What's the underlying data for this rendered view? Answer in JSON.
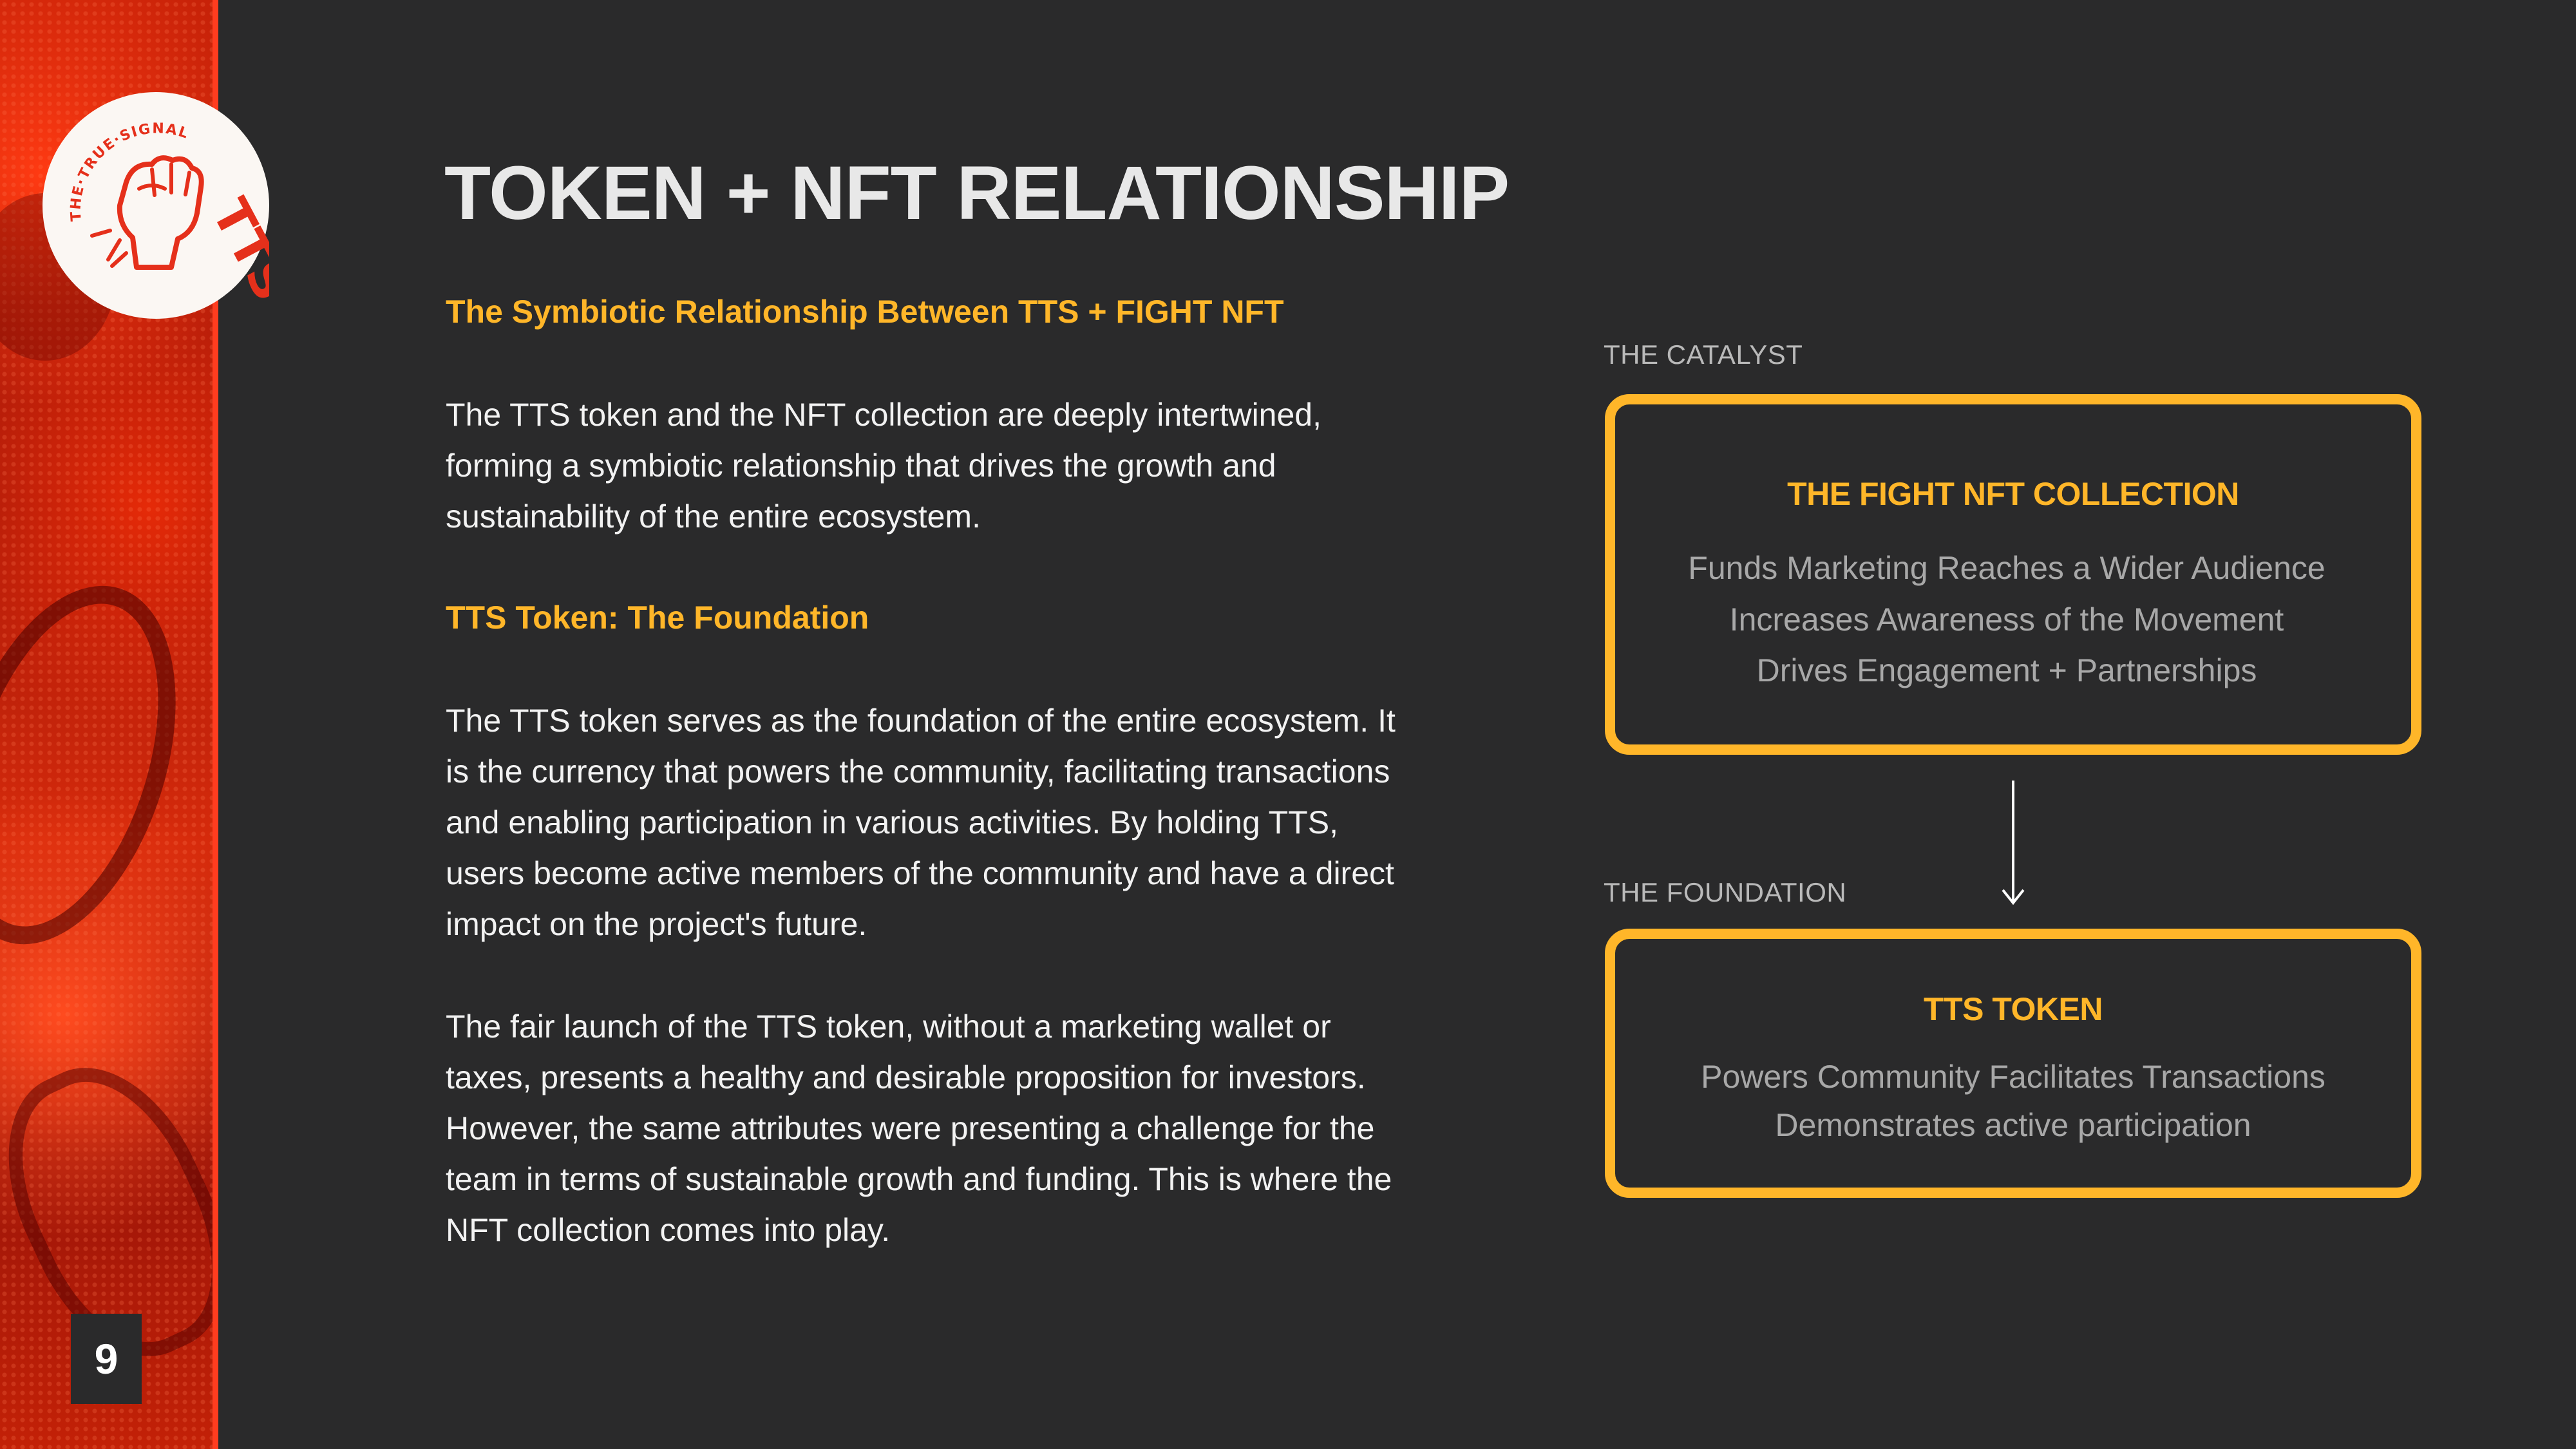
{
  "page": {
    "number": "9",
    "title": "TOKEN + NFT RELATIONSHIP"
  },
  "logo": {
    "text_top": "THE·TRUE·SIGNAL",
    "text_side": "TTS",
    "icon": "raised-fist-icon"
  },
  "left": {
    "subheading_1": "The Symbiotic Relationship Between TTS + FIGHT NFT",
    "paragraph_1": "The TTS token and the NFT collection are deeply intertwined, forming a symbiotic relationship that drives the growth and sustainability of the entire ecosystem.",
    "subheading_2": "TTS Token: The Foundation",
    "paragraph_2": "The TTS token serves as the foundation of the entire ecosystem. It is the currency that powers the community, facilitating transactions and enabling participation in various activities. By holding TTS, users become active members of the community and have a direct impact on the project's future.",
    "paragraph_3": "The fair launch of the TTS token, without a marketing wallet or taxes, presents a healthy and desirable proposition for investors. However, the same attributes were presenting a challenge for the team in terms of sustainable growth and funding. This is where the NFT collection comes into play."
  },
  "diagram": {
    "catalyst": {
      "label": "THE CATALYST",
      "title": "THE FIGHT NFT COLLECTION",
      "line_1": "Funds Marketing   Reaches a Wider Audience",
      "line_2": "Increases Awareness of the Movement",
      "line_3": "Drives Engagement + Partnerships"
    },
    "arrow_icon": "arrow-down-icon",
    "foundation": {
      "label": "THE FOUNDATION",
      "title": "TTS TOKEN",
      "line_1": "Powers Community  Facilitates Transactions",
      "line_2": "Demonstrates active participation"
    }
  },
  "colors": {
    "background": "#2a2a2b",
    "accent": "#ffb629",
    "sidebar_red": "#c82208",
    "divider": "#ff3d1f"
  }
}
